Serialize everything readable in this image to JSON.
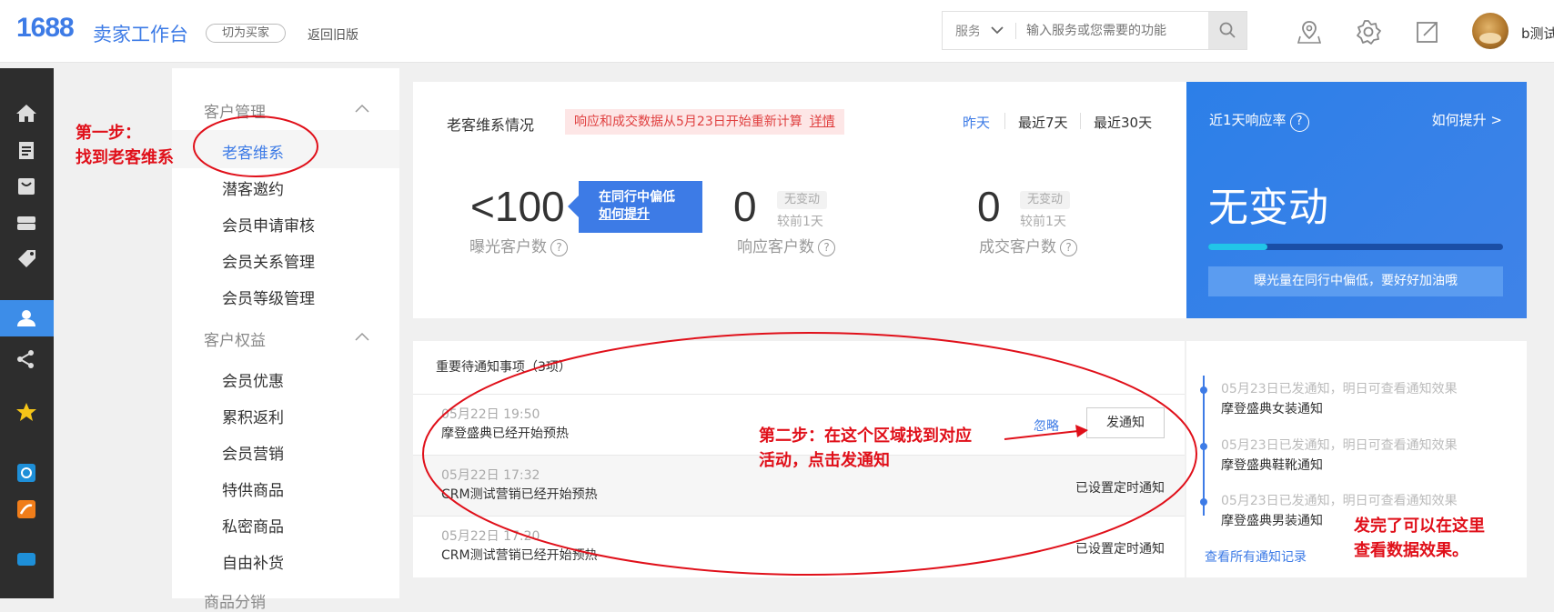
{
  "header": {
    "logo_num": "1688",
    "logo_text": "卖家工作台",
    "switch_label": "切为买家",
    "old_version_label": "返回旧版",
    "search_select": "服务",
    "search_placeholder": "输入服务或您需要的功能",
    "username": "b测试"
  },
  "sidebar_groups": [
    {
      "title": "客户管理",
      "items": [
        "老客维系",
        "潜客邀约",
        "会员申请审核",
        "会员关系管理",
        "会员等级管理"
      ]
    },
    {
      "title": "客户权益",
      "items": [
        "会员优惠",
        "累积返利",
        "会员营销",
        "特供商品",
        "私密商品",
        "自由补货"
      ]
    },
    {
      "title": "商品分销"
    }
  ],
  "overview": {
    "title": "老客维系情况",
    "notice_text": "响应和成交数据从5月23日开始重新计算",
    "notice_link": "详情",
    "ranges": [
      "昨天",
      "最近7天",
      "最近30天"
    ],
    "selected_range": "昨天",
    "metrics": [
      {
        "value": "<100",
        "label": "曝光客户数"
      },
      {
        "value": "0",
        "label": "响应客户数",
        "tag": "无变动",
        "compare": "较前1天"
      },
      {
        "value": "0",
        "label": "成交客户数",
        "tag": "无变动",
        "compare": "较前1天"
      }
    ],
    "tip_line1": "在同行中偏低",
    "tip_link": "如何提升"
  },
  "response_rate": {
    "title": "近1天响应率",
    "improve_link": "如何提升 >",
    "status": "无变动",
    "progress": 0.2,
    "message": "曝光量在同行中偏低，要好好加油哦"
  },
  "todo": {
    "title": "重要待通知事项（3项）",
    "ignore_label": "忽略",
    "notify_label": "发通知",
    "rows": [
      {
        "time": "05月22日 19:50",
        "text": "摩登盛典已经开始预热",
        "status": ""
      },
      {
        "time": "05月22日 17:32",
        "text": "CRM测试营销已经开始预热",
        "status": "已设置定时通知"
      },
      {
        "time": "05月22日 17:20",
        "text": "CRM测试营销已经开始预热",
        "status": "已设置定时通知"
      }
    ]
  },
  "history": {
    "items": [
      {
        "time": "05月23日已发通知，明日可查看通知效果",
        "text": "摩登盛典女装通知"
      },
      {
        "time": "05月23日已发通知，明日可查看通知效果",
        "text": "摩登盛典鞋靴通知"
      },
      {
        "time": "05月23日已发通知，明日可查看通知效果",
        "text": "摩登盛典男装通知"
      }
    ],
    "link": "查看所有通知记录"
  },
  "annotations": {
    "step1_line1": "第一步：",
    "step1_line2": "找到老客维系",
    "step2_line1": "第二步：在这个区域找到对应",
    "step2_line2": "活动，点击发通知",
    "step3_line1": "发完了可以在这里",
    "step3_line2": "查看数据效果。"
  },
  "colors": {
    "accent": "#3d7be6",
    "annotation": "#e0101a",
    "rail": "#2d2d2d"
  }
}
